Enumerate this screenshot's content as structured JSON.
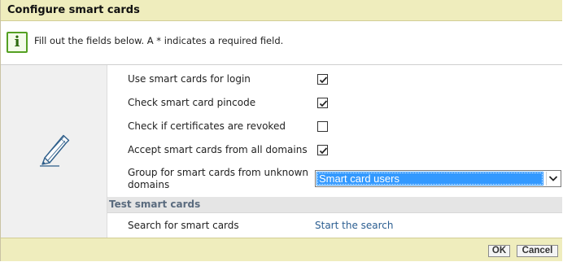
{
  "dialog": {
    "title": "Configure smart cards"
  },
  "info": {
    "icon": "info-icon",
    "icon_glyph": "i",
    "text": "Fill out the fields below. A * indicates a required field."
  },
  "side_icon": "pencil-icon",
  "form": {
    "rows": [
      {
        "label": "Use smart cards for login",
        "checked": true
      },
      {
        "label": "Check smart card pincode",
        "checked": true
      },
      {
        "label": "Check if certificates are revoked",
        "checked": false
      },
      {
        "label": "Accept smart cards from all domains",
        "checked": true
      }
    ],
    "group": {
      "label_line1": "Group for smart cards from unknown",
      "label_line2": "domains",
      "selected": "Smart card users"
    }
  },
  "test_section": {
    "header": "Test smart cards",
    "search_label": "Search for smart cards",
    "search_link": "Start the search"
  },
  "buttons": {
    "ok": "OK",
    "cancel": "Cancel"
  },
  "colors": {
    "title_bar": "#efedbd",
    "info_icon_green": "#54a022",
    "selection_blue": "#3399ff",
    "link_blue": "#2b5e91",
    "section_header_text": "#5a6b7e"
  }
}
